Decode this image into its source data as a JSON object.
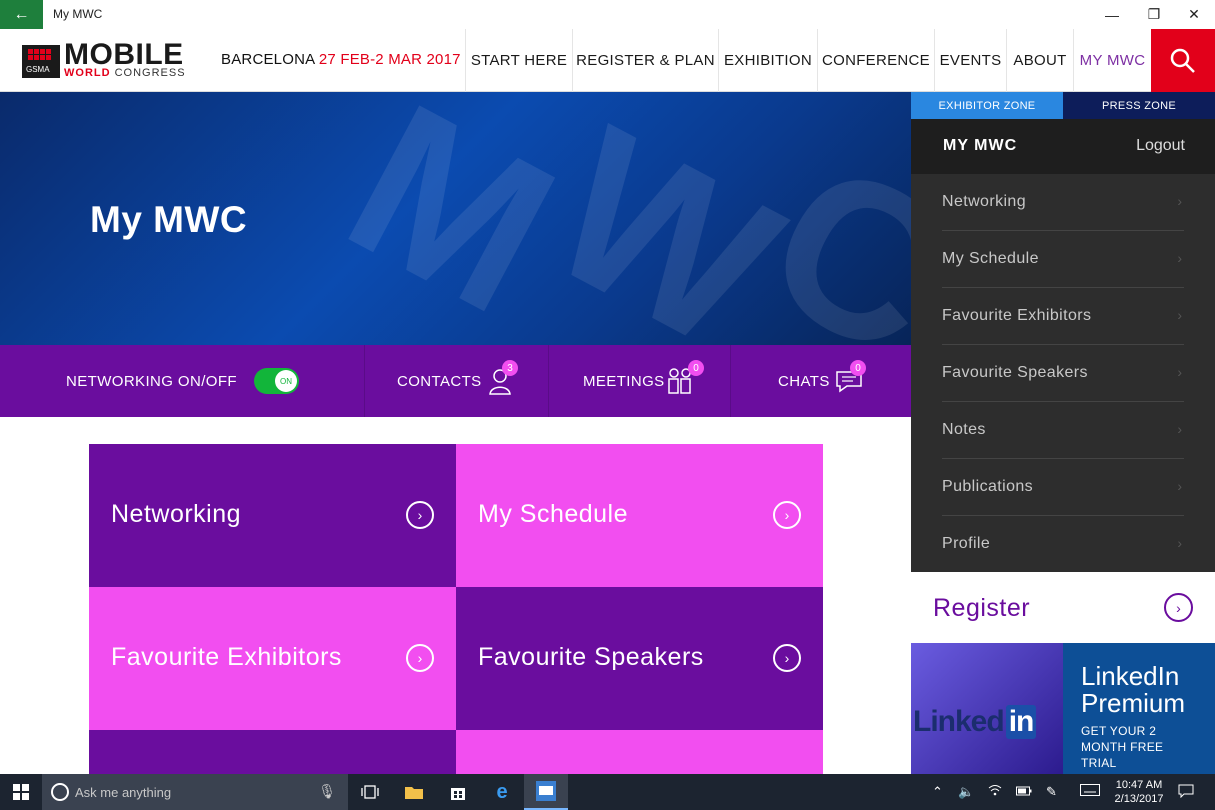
{
  "window": {
    "title": "My MWC",
    "back_icon": "←",
    "minimize": "—",
    "maximize": "❐",
    "close": "✕"
  },
  "header": {
    "logo_main": "MOBILE",
    "logo_world": "WORLD",
    "logo_congress": "CONGRESS",
    "logo_gsma": "GSMA",
    "city": "BARCELONA",
    "dates": "27 FEB-2 MAR 2017",
    "nav": [
      {
        "label": "START HERE"
      },
      {
        "label": "REGISTER & PLAN"
      },
      {
        "label": "EXHIBITION"
      },
      {
        "label": "CONFERENCE"
      },
      {
        "label": "EVENTS"
      },
      {
        "label": "ABOUT"
      },
      {
        "label": "MY MWC",
        "active": true
      }
    ],
    "accent_color": "#e2001a"
  },
  "hero": {
    "title": "My MWC"
  },
  "networking_bar": {
    "toggle_label": "NETWORKING ON/OFF",
    "toggle_state": "ON",
    "contacts_label": "CONTACTS",
    "contacts_count": "3",
    "meetings_label": "MEETINGS",
    "meetings_count": "0",
    "chats_label": "CHATS",
    "chats_count": "0"
  },
  "tiles": [
    {
      "label": "Networking",
      "arrow": "›"
    },
    {
      "label": "My Schedule",
      "arrow": "›"
    },
    {
      "label": "Favourite Exhibitors",
      "arrow": "›"
    },
    {
      "label": "Favourite Speakers",
      "arrow": "›"
    }
  ],
  "sidebar": {
    "exhibitor_zone": "EXHIBITOR ZONE",
    "press_zone": "PRESS ZONE",
    "title": "MY MWC",
    "logout": "Logout",
    "chevron": "›",
    "items": [
      {
        "label": "Networking"
      },
      {
        "label": "My Schedule"
      },
      {
        "label": "Favourite Exhibitors"
      },
      {
        "label": "Favourite Speakers"
      },
      {
        "label": "Notes"
      },
      {
        "label": "Publications"
      },
      {
        "label": "Profile"
      }
    ],
    "register": "Register",
    "register_arrow": "›"
  },
  "ad": {
    "logo_text": "Linked",
    "logo_in": "in",
    "title": "LinkedIn Premium",
    "subtitle": "GET YOUR 2 MONTH FREE TRIAL"
  },
  "taskbar": {
    "search_placeholder": "Ask me anything",
    "time": "10:47 AM",
    "date": "2/13/2017"
  },
  "colors": {
    "purple": "#6a0d9e",
    "pink": "#f24ef0",
    "green_toggle": "#12b53a",
    "zone_blue": "#2a87e0",
    "press_navy": "#0d1d5a"
  }
}
